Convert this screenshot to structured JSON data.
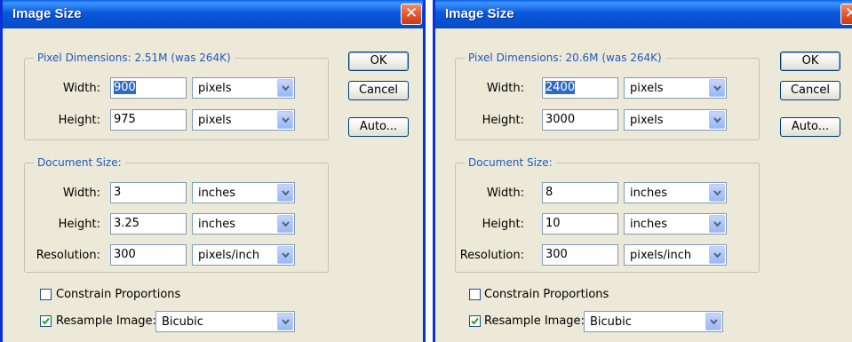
{
  "dialogs": [
    {
      "title": "Image Size",
      "close_glyph": "✕",
      "pixel_dimensions_legend": "Pixel Dimensions:  2.51M (was 264K)",
      "px_width_label": "Width:",
      "px_width_value": "900",
      "px_width_unit": "pixels",
      "px_height_label": "Height:",
      "px_height_value": "975",
      "px_height_unit": "pixels",
      "document_size_legend": "Document Size:",
      "doc_width_label": "Width:",
      "doc_width_value": "3",
      "doc_width_unit": "inches",
      "doc_height_label": "Height:",
      "doc_height_value": "3.25",
      "doc_height_unit": "inches",
      "resolution_label": "Resolution:",
      "resolution_value": "300",
      "resolution_unit": "pixels/inch",
      "constrain_label": "Constrain Proportions",
      "constrain_checked": false,
      "resample_label": "Resample Image:",
      "resample_checked": true,
      "resample_method": "Bicubic",
      "ok_label": "OK",
      "cancel_label": "Cancel",
      "auto_label": "Auto..."
    },
    {
      "title": "Image Size",
      "close_glyph": "✕",
      "pixel_dimensions_legend": "Pixel Dimensions:  20.6M (was 264K)",
      "px_width_label": "Width:",
      "px_width_value": "2400",
      "px_width_unit": "pixels",
      "px_height_label": "Height:",
      "px_height_value": "3000",
      "px_height_unit": "pixels",
      "document_size_legend": "Document Size:",
      "doc_width_label": "Width:",
      "doc_width_value": "8",
      "doc_width_unit": "inches",
      "doc_height_label": "Height:",
      "doc_height_value": "10",
      "doc_height_unit": "inches",
      "resolution_label": "Resolution:",
      "resolution_value": "300",
      "resolution_unit": "pixels/inch",
      "constrain_label": "Constrain Proportions",
      "constrain_checked": false,
      "resample_label": "Resample Image:",
      "resample_checked": true,
      "resample_method": "Bicubic",
      "ok_label": "OK",
      "cancel_label": "Cancel",
      "auto_label": "Auto..."
    }
  ],
  "icons": {
    "close": "close-icon",
    "dropdown": "chevron-down-icon",
    "check": "checkmark-icon"
  },
  "colors": {
    "title_bar": "#0a58d9",
    "dialog_bg": "#ece9d8",
    "legend_text": "#2159c0",
    "selection": "#316ac5",
    "close_button": "#e2562b"
  }
}
